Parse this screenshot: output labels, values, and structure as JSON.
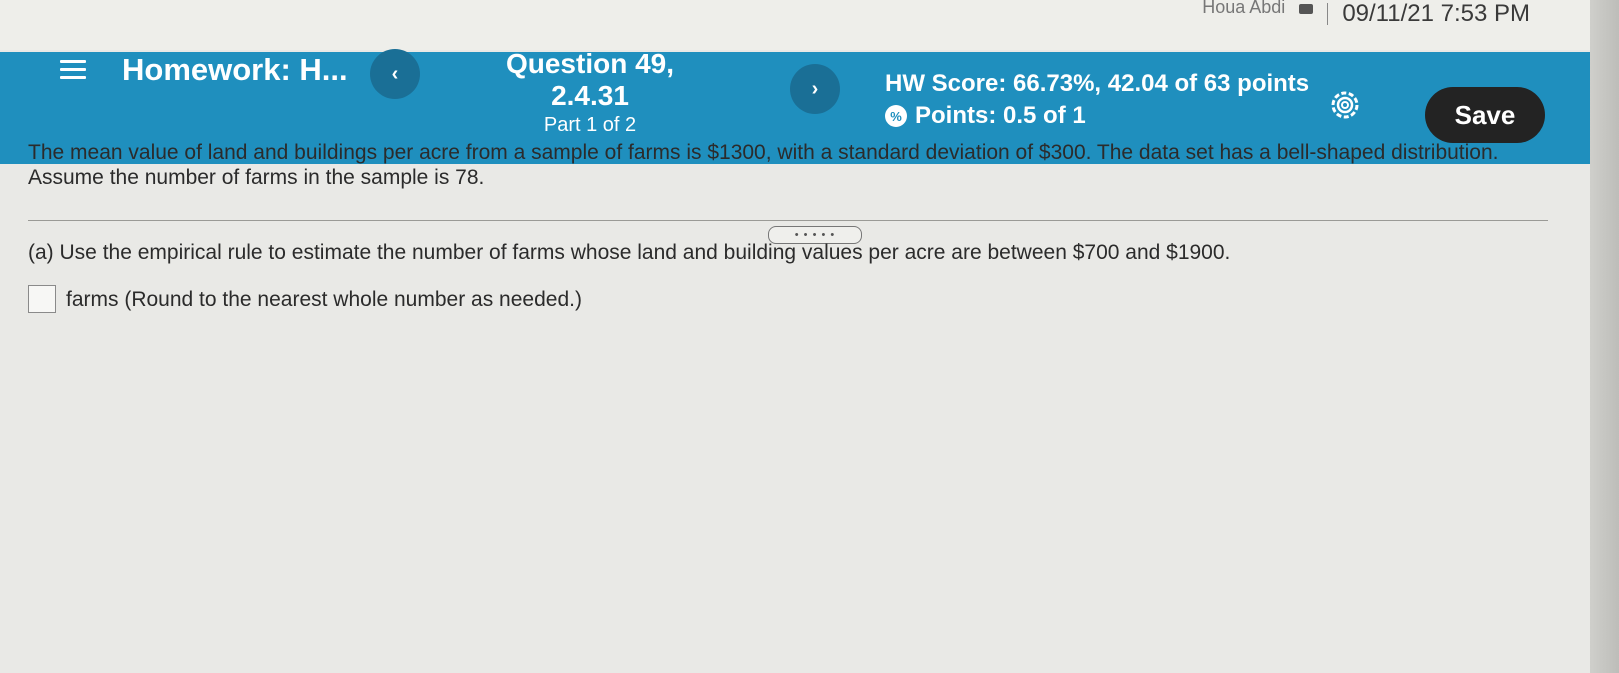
{
  "system": {
    "user": "Houa Abdi",
    "datetime": "09/11/21 7:53 PM"
  },
  "header": {
    "homework_title": "Homework: H...",
    "prev_label": "‹",
    "next_label": "›",
    "question_title": "Question 49, 2.4.31",
    "question_part": "Part 1 of 2",
    "hw_score": "HW Score: 66.73%, 42.04 of 63 points",
    "points": "Points: 0.5 of 1",
    "save_label": "Save",
    "accent_color": "#1f8fbe"
  },
  "problem": {
    "line1": "The mean value of land and buildings per acre from a sample of farms is $1300, with a standard deviation of $300. The data set has a bell-shaped distribution.",
    "line2": "Assume the number of farms in the sample is 78.",
    "expand_label": "• • • • •",
    "part_a_label": "(a)",
    "part_a_text": "Use the empirical rule to estimate the number of farms whose land and building values per acre are between $700 and $1900.",
    "answer_suffix": "farms (Round to the nearest whole number as needed.)",
    "answer_value": ""
  }
}
